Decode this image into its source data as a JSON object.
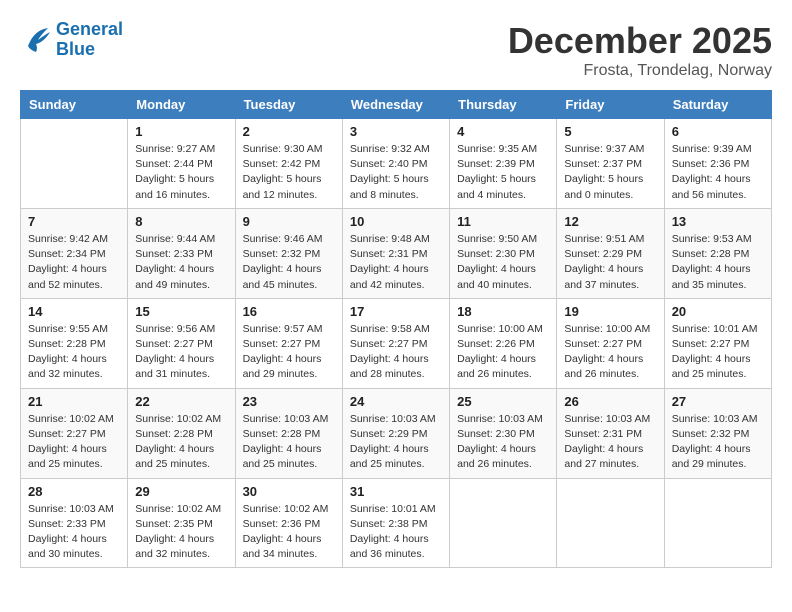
{
  "logo": {
    "line1": "General",
    "line2": "Blue"
  },
  "title": "December 2025",
  "location": "Frosta, Trondelag, Norway",
  "days_of_week": [
    "Sunday",
    "Monday",
    "Tuesday",
    "Wednesday",
    "Thursday",
    "Friday",
    "Saturday"
  ],
  "weeks": [
    [
      {
        "num": "",
        "info": ""
      },
      {
        "num": "1",
        "info": "Sunrise: 9:27 AM\nSunset: 2:44 PM\nDaylight: 5 hours\nand 16 minutes."
      },
      {
        "num": "2",
        "info": "Sunrise: 9:30 AM\nSunset: 2:42 PM\nDaylight: 5 hours\nand 12 minutes."
      },
      {
        "num": "3",
        "info": "Sunrise: 9:32 AM\nSunset: 2:40 PM\nDaylight: 5 hours\nand 8 minutes."
      },
      {
        "num": "4",
        "info": "Sunrise: 9:35 AM\nSunset: 2:39 PM\nDaylight: 5 hours\nand 4 minutes."
      },
      {
        "num": "5",
        "info": "Sunrise: 9:37 AM\nSunset: 2:37 PM\nDaylight: 5 hours\nand 0 minutes."
      },
      {
        "num": "6",
        "info": "Sunrise: 9:39 AM\nSunset: 2:36 PM\nDaylight: 4 hours\nand 56 minutes."
      }
    ],
    [
      {
        "num": "7",
        "info": "Sunrise: 9:42 AM\nSunset: 2:34 PM\nDaylight: 4 hours\nand 52 minutes."
      },
      {
        "num": "8",
        "info": "Sunrise: 9:44 AM\nSunset: 2:33 PM\nDaylight: 4 hours\nand 49 minutes."
      },
      {
        "num": "9",
        "info": "Sunrise: 9:46 AM\nSunset: 2:32 PM\nDaylight: 4 hours\nand 45 minutes."
      },
      {
        "num": "10",
        "info": "Sunrise: 9:48 AM\nSunset: 2:31 PM\nDaylight: 4 hours\nand 42 minutes."
      },
      {
        "num": "11",
        "info": "Sunrise: 9:50 AM\nSunset: 2:30 PM\nDaylight: 4 hours\nand 40 minutes."
      },
      {
        "num": "12",
        "info": "Sunrise: 9:51 AM\nSunset: 2:29 PM\nDaylight: 4 hours\nand 37 minutes."
      },
      {
        "num": "13",
        "info": "Sunrise: 9:53 AM\nSunset: 2:28 PM\nDaylight: 4 hours\nand 35 minutes."
      }
    ],
    [
      {
        "num": "14",
        "info": "Sunrise: 9:55 AM\nSunset: 2:28 PM\nDaylight: 4 hours\nand 32 minutes."
      },
      {
        "num": "15",
        "info": "Sunrise: 9:56 AM\nSunset: 2:27 PM\nDaylight: 4 hours\nand 31 minutes."
      },
      {
        "num": "16",
        "info": "Sunrise: 9:57 AM\nSunset: 2:27 PM\nDaylight: 4 hours\nand 29 minutes."
      },
      {
        "num": "17",
        "info": "Sunrise: 9:58 AM\nSunset: 2:27 PM\nDaylight: 4 hours\nand 28 minutes."
      },
      {
        "num": "18",
        "info": "Sunrise: 10:00 AM\nSunset: 2:26 PM\nDaylight: 4 hours\nand 26 minutes."
      },
      {
        "num": "19",
        "info": "Sunrise: 10:00 AM\nSunset: 2:27 PM\nDaylight: 4 hours\nand 26 minutes."
      },
      {
        "num": "20",
        "info": "Sunrise: 10:01 AM\nSunset: 2:27 PM\nDaylight: 4 hours\nand 25 minutes."
      }
    ],
    [
      {
        "num": "21",
        "info": "Sunrise: 10:02 AM\nSunset: 2:27 PM\nDaylight: 4 hours\nand 25 minutes."
      },
      {
        "num": "22",
        "info": "Sunrise: 10:02 AM\nSunset: 2:28 PM\nDaylight: 4 hours\nand 25 minutes."
      },
      {
        "num": "23",
        "info": "Sunrise: 10:03 AM\nSunset: 2:28 PM\nDaylight: 4 hours\nand 25 minutes."
      },
      {
        "num": "24",
        "info": "Sunrise: 10:03 AM\nSunset: 2:29 PM\nDaylight: 4 hours\nand 25 minutes."
      },
      {
        "num": "25",
        "info": "Sunrise: 10:03 AM\nSunset: 2:30 PM\nDaylight: 4 hours\nand 26 minutes."
      },
      {
        "num": "26",
        "info": "Sunrise: 10:03 AM\nSunset: 2:31 PM\nDaylight: 4 hours\nand 27 minutes."
      },
      {
        "num": "27",
        "info": "Sunrise: 10:03 AM\nSunset: 2:32 PM\nDaylight: 4 hours\nand 29 minutes."
      }
    ],
    [
      {
        "num": "28",
        "info": "Sunrise: 10:03 AM\nSunset: 2:33 PM\nDaylight: 4 hours\nand 30 minutes."
      },
      {
        "num": "29",
        "info": "Sunrise: 10:02 AM\nSunset: 2:35 PM\nDaylight: 4 hours\nand 32 minutes."
      },
      {
        "num": "30",
        "info": "Sunrise: 10:02 AM\nSunset: 2:36 PM\nDaylight: 4 hours\nand 34 minutes."
      },
      {
        "num": "31",
        "info": "Sunrise: 10:01 AM\nSunset: 2:38 PM\nDaylight: 4 hours\nand 36 minutes."
      },
      {
        "num": "",
        "info": ""
      },
      {
        "num": "",
        "info": ""
      },
      {
        "num": "",
        "info": ""
      }
    ]
  ]
}
